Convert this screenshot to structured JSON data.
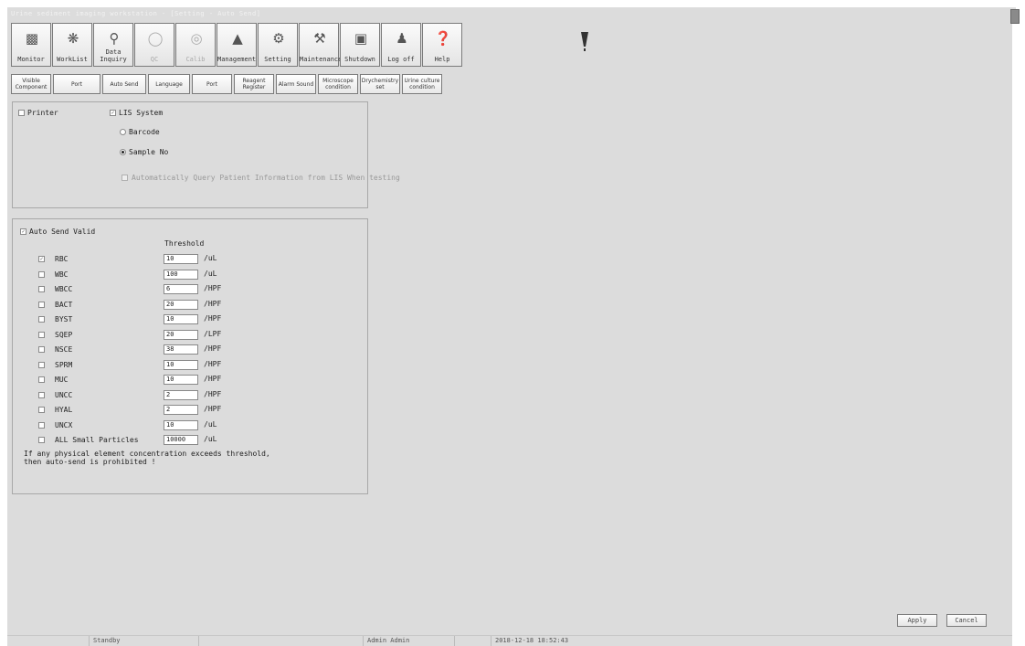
{
  "window": {
    "title": "Urine sediment imaging workstation - [Setting - Auto Send]"
  },
  "toolbar": {
    "buttons": [
      {
        "label": "Monitor",
        "icon": "printer-icon"
      },
      {
        "label": "WorkList",
        "icon": "worklist-icon"
      },
      {
        "label": "Data Inquiry",
        "icon": "magnifier-icon"
      },
      {
        "label": "QC",
        "icon": "qc-icon"
      },
      {
        "label": "Calib",
        "icon": "calib-icon"
      },
      {
        "label": "Management",
        "icon": "user-icon"
      },
      {
        "label": "Setting",
        "icon": "gears-icon"
      },
      {
        "label": "Maintenance",
        "icon": "tools-icon"
      },
      {
        "label": "Shutdown",
        "icon": "power-icon"
      },
      {
        "label": "Log off",
        "icon": "logoff-icon"
      },
      {
        "label": "Help",
        "icon": "help-icon"
      }
    ]
  },
  "subtabs": [
    "Visible Component",
    "Port",
    "Auto Send",
    "Language",
    "Port",
    "Reagent Register",
    "Alarm Sound",
    "Microscope condition",
    "Drychemistry set",
    "Urine culture condition"
  ],
  "send_target": {
    "printer_label": "Printer",
    "lis_label": "LIS System",
    "lis_checked": true,
    "barcode_label": "Barcode",
    "sample_no_label": "Sample No",
    "sample_no_selected": true,
    "auto_query_label": "Automatically Query Patient Information from LIS When testing"
  },
  "auto_send": {
    "valid_label": "Auto Send Valid",
    "valid_checked": true,
    "threshold_header": "Threshold",
    "rows": [
      {
        "name": "RBC",
        "value": "10",
        "unit": "/uL",
        "checked": true
      },
      {
        "name": "WBC",
        "value": "100",
        "unit": "/uL",
        "checked": false
      },
      {
        "name": "WBCC",
        "value": "6",
        "unit": "/HPF",
        "checked": false
      },
      {
        "name": "BACT",
        "value": "20",
        "unit": "/HPF",
        "checked": false
      },
      {
        "name": "BYST",
        "value": "10",
        "unit": "/HPF",
        "checked": false
      },
      {
        "name": "SQEP",
        "value": "20",
        "unit": "/LPF",
        "checked": false
      },
      {
        "name": "NSCE",
        "value": "38",
        "unit": "/HPF",
        "checked": false
      },
      {
        "name": "SPRM",
        "value": "10",
        "unit": "/HPF",
        "checked": false
      },
      {
        "name": "MUC",
        "value": "10",
        "unit": "/HPF",
        "checked": false
      },
      {
        "name": "UNCC",
        "value": "2",
        "unit": "/HPF",
        "checked": false
      },
      {
        "name": "HYAL",
        "value": "2",
        "unit": "/HPF",
        "checked": false
      },
      {
        "name": "UNCX",
        "value": "10",
        "unit": "/uL",
        "checked": false
      },
      {
        "name": "ALL Small Particles",
        "value": "10000",
        "unit": "/uL",
        "checked": false
      }
    ],
    "note_line1": "If any physical element concentration exceeds threshold,",
    "note_line2": "then auto-send is prohibited !"
  },
  "actions": {
    "apply": "Apply",
    "cancel": "Cancel"
  },
  "status": {
    "state": "Standby",
    "user": "Admin Admin",
    "datetime": "2018-12-18 18:52:43"
  }
}
